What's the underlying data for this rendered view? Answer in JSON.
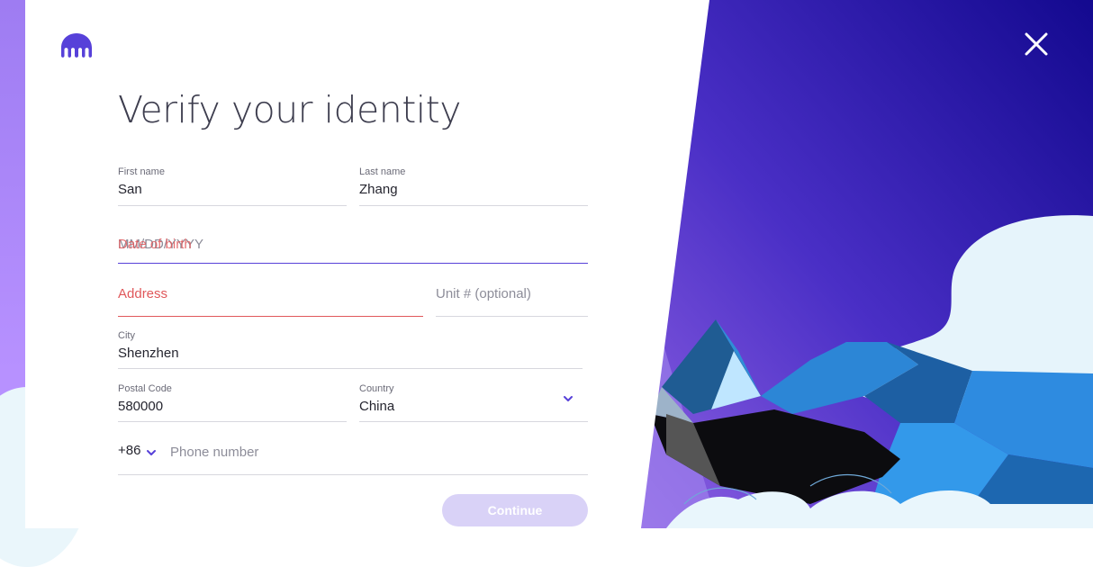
{
  "page": {
    "title": "Verify your identity"
  },
  "brand": {
    "accent": "#5741d9",
    "error": "#e0585b",
    "button_disabled_bg": "#d9d2f7",
    "logo_icon": "kraken-logo-icon"
  },
  "form": {
    "first_name": {
      "label": "First name",
      "value": "San"
    },
    "last_name": {
      "label": "Last name",
      "value": "Zhang"
    },
    "dob": {
      "label": "Date of birth",
      "placeholder": "MM/DD/YYYY"
    },
    "address": {
      "label": "Address"
    },
    "unit": {
      "placeholder": "Unit # (optional)"
    },
    "city": {
      "label": "City",
      "value": "Shenzhen"
    },
    "postal_code": {
      "label": "Postal Code",
      "value": "580000"
    },
    "country": {
      "label": "Country",
      "value": "China"
    },
    "phone": {
      "country_code": "+86",
      "placeholder": "Phone number"
    }
  },
  "actions": {
    "continue_label": "Continue"
  },
  "header": {
    "close_icon": "close-icon"
  }
}
